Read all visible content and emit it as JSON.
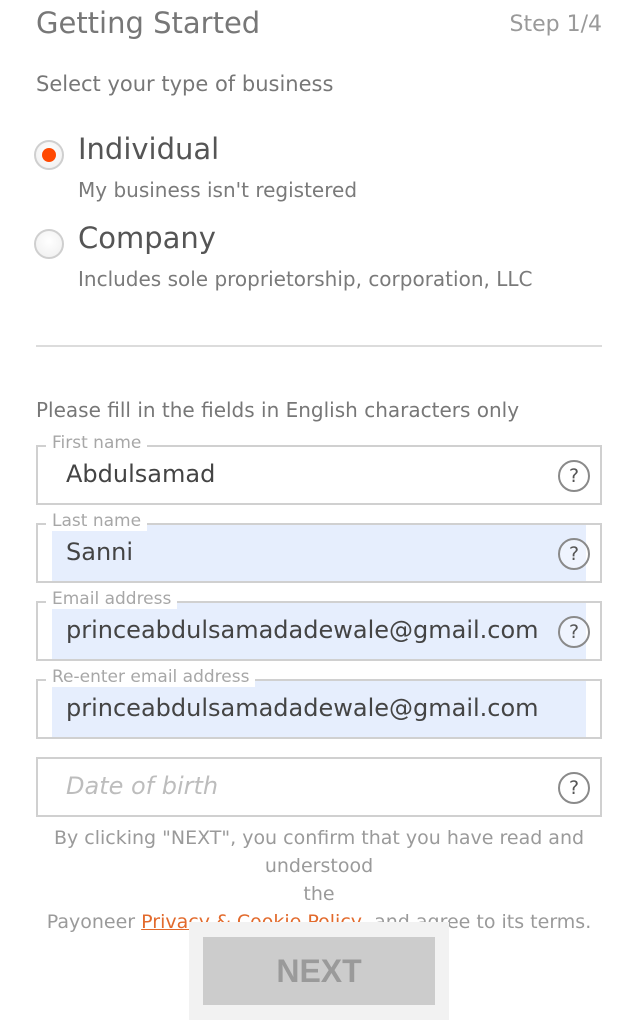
{
  "header": {
    "title": "Getting Started",
    "step": "Step 1/4"
  },
  "business_type": {
    "prompt": "Select your type of business",
    "options": [
      {
        "label": "Individual",
        "description": "My business isn't registered",
        "selected": true
      },
      {
        "label": "Company",
        "description": "Includes sole proprietorship, corporation, LLC",
        "selected": false
      }
    ]
  },
  "form": {
    "hint": "Please fill in the fields in English characters only",
    "first_name": {
      "label": "First name",
      "value": "Abdulsamad",
      "autofilled": false
    },
    "last_name": {
      "label": "Last name",
      "value": "Sanni",
      "autofilled": true
    },
    "email": {
      "label": "Email address",
      "value": "princeabdulsamadadewale@gmail.com",
      "autofilled": true
    },
    "email_confirm": {
      "label": "Re-enter email address",
      "value": "princeabdulsamadadewale@gmail.com",
      "autofilled": true
    },
    "date_of_birth": {
      "placeholder": "Date of birth",
      "value": ""
    },
    "help_symbol": "?"
  },
  "terms": {
    "line1": "By clicking \"NEXT\", you confirm that you have read and understood",
    "line2": "the",
    "prefix": "Payoneer ",
    "link": "Privacy & Cookie Policy",
    "suffix": ", and agree to its terms."
  },
  "actions": {
    "next_label": "NEXT"
  },
  "colors": {
    "accent": "#ff4800",
    "link": "#e26a2c",
    "autofill": "#e6eefd",
    "button_disabled": "#cccccc"
  }
}
